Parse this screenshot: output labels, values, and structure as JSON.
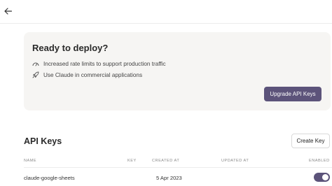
{
  "banner": {
    "title": "Ready to deploy?",
    "features": [
      {
        "icon": "speedometer-icon",
        "text": "Increased rate limits to support production traffic"
      },
      {
        "icon": "rocket-icon",
        "text": "Use Claude in commercial applications"
      }
    ],
    "upgrade_label": "Upgrade API Keys"
  },
  "api_keys": {
    "title": "API Keys",
    "create_label": "Create Key",
    "columns": {
      "name": "NAME",
      "key": "KEY",
      "created_at": "CREATED AT",
      "updated_at": "UPDATED AT",
      "enabled": "ENABLED"
    },
    "rows": [
      {
        "name": "claude-google-sheets",
        "key": "",
        "created_at": "5 Apr 2023",
        "updated_at": "",
        "enabled": true
      }
    ]
  },
  "colors": {
    "accent": "#5c537a",
    "card_bg": "#f6f5f3"
  }
}
